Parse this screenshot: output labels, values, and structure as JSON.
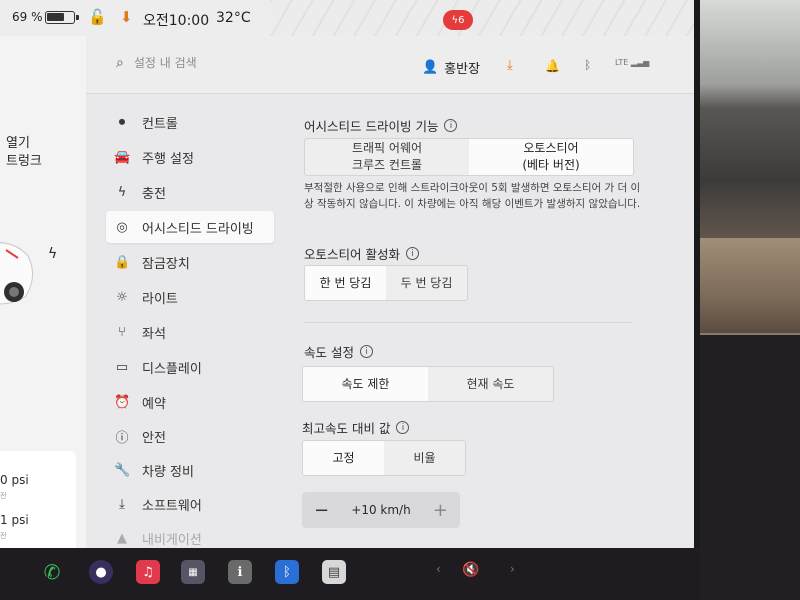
{
  "status": {
    "battery_pct": "69 %",
    "battery_level": 0.69,
    "time": "오전10:00",
    "temperature": "32°C",
    "alert_count": "6"
  },
  "car_panel": {
    "open_label": "열기",
    "trunk_label": "트렁크",
    "tire_1": "0 psi",
    "tire_1_sub": "전",
    "tire_2": "1 psi",
    "tire_2_sub": "전"
  },
  "header": {
    "search_placeholder": "설정 내 검색",
    "profile_name": "홍반장",
    "lte_label": "LTE"
  },
  "sidebar": {
    "items": [
      {
        "label": "컨트롤",
        "icon": "toggle-icon"
      },
      {
        "label": "주행 설정",
        "icon": "car-icon"
      },
      {
        "label": "충전",
        "icon": "bolt-icon"
      },
      {
        "label": "어시스티드 드라이빙",
        "icon": "steering-wheel-icon"
      },
      {
        "label": "잠금장치",
        "icon": "lock-icon"
      },
      {
        "label": "라이트",
        "icon": "light-icon"
      },
      {
        "label": "좌석",
        "icon": "seat-icon"
      },
      {
        "label": "디스플레이",
        "icon": "display-icon"
      },
      {
        "label": "예약",
        "icon": "clock-icon"
      },
      {
        "label": "안전",
        "icon": "info-circle-icon"
      },
      {
        "label": "차량 정비",
        "icon": "wrench-icon"
      },
      {
        "label": "소프트웨어",
        "icon": "download-icon"
      },
      {
        "label": "내비게이션",
        "icon": "navigation-icon"
      }
    ],
    "active_index": 3
  },
  "content": {
    "assisted_title": "어시스티드 드라이빙 기능",
    "assisted_options": [
      "트래픽 어웨어\n크루즈 컨트롤",
      "오토스티어\n(베타 버전)"
    ],
    "assisted_selected": 1,
    "assisted_desc": "부적절한 사용으로 인해 스트라이크아웃이 5회 발생하면 오토스티어 가 더 이상 작동하지 않습니다. 이 차량에는 아직 해당 이벤트가 발생하지 않았습니다.",
    "activation_title": "오토스티어 활성화",
    "activation_options": [
      "한 번 당김",
      "두 번 당김"
    ],
    "activation_selected": 0,
    "speed_title": "속도 설정",
    "speed_options": [
      "속도 제한",
      "현재 속도"
    ],
    "speed_selected": 0,
    "offset_title": "최고속도 대비 값",
    "offset_options": [
      "고정",
      "비율"
    ],
    "offset_selected": 0,
    "offset_value": "+10 km/h",
    "minus": "−",
    "plus": "+"
  },
  "taskbar": {
    "apps": [
      "phone",
      "camera",
      "music",
      "games",
      "info",
      "bluetooth",
      "calendar"
    ]
  }
}
